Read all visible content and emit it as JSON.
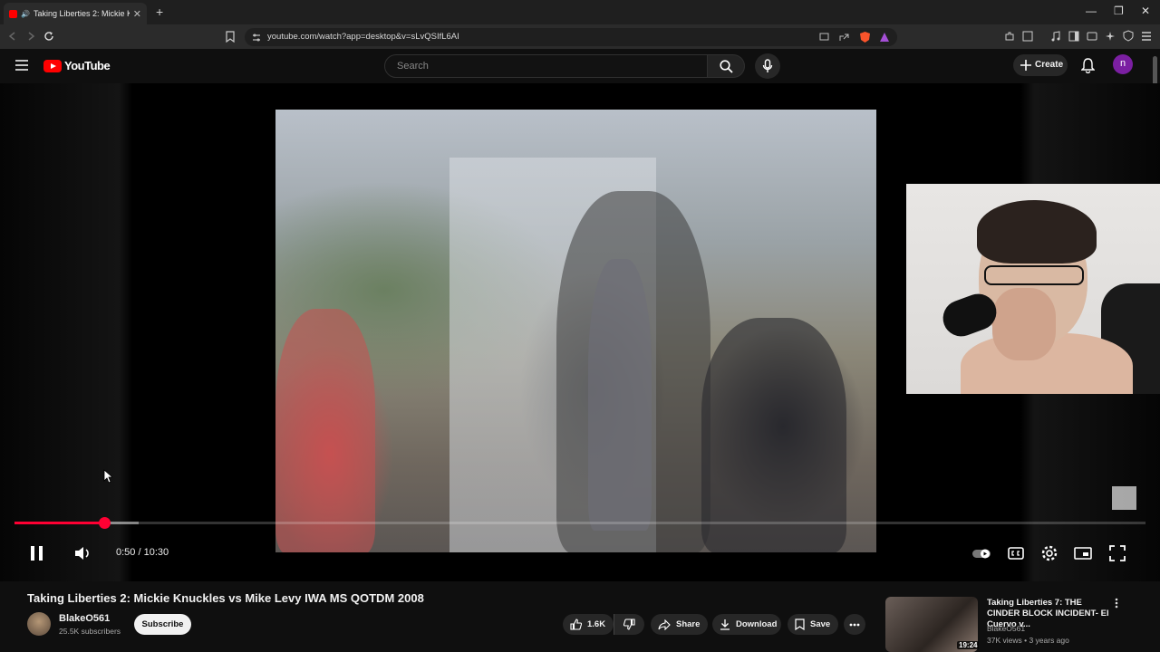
{
  "browser": {
    "tab_title": "Taking Liberties 2: Mickie Knu...",
    "tab_close": "✕",
    "new_tab": "+",
    "url": "youtube.com/watch?app=desktop&v=sLvQSIfL6AI",
    "win_min": "—",
    "win_restore": "❐",
    "win_close": "✕"
  },
  "youtube": {
    "logo_text": "YouTube",
    "search_placeholder": "Search",
    "create_label": "Create",
    "avatar_letter": "n"
  },
  "player": {
    "time": "0:50 / 10:30",
    "progress_fraction": 0.079,
    "buffer_fraction": 0.11
  },
  "video": {
    "title": "Taking Liberties 2: Mickie Knuckles vs Mike Levy IWA MS QOTDM 2008",
    "channel": "BlakeO561",
    "subscribers": "25.5K subscribers",
    "subscribe_label": "Subscribe",
    "likes": "1.6K",
    "share_label": "Share",
    "download_label": "Download",
    "save_label": "Save"
  },
  "recommendation": {
    "title": "Taking Liberties 7: THE CINDER BLOCK INCIDENT- El Cuervo v...",
    "channel": "BlakeO561",
    "meta": "37K views • 3 years ago",
    "duration": "19:24"
  },
  "colors": {
    "accent": "#ff0033",
    "background": "#0f0f0f",
    "avatar": "#7b1fa2"
  }
}
